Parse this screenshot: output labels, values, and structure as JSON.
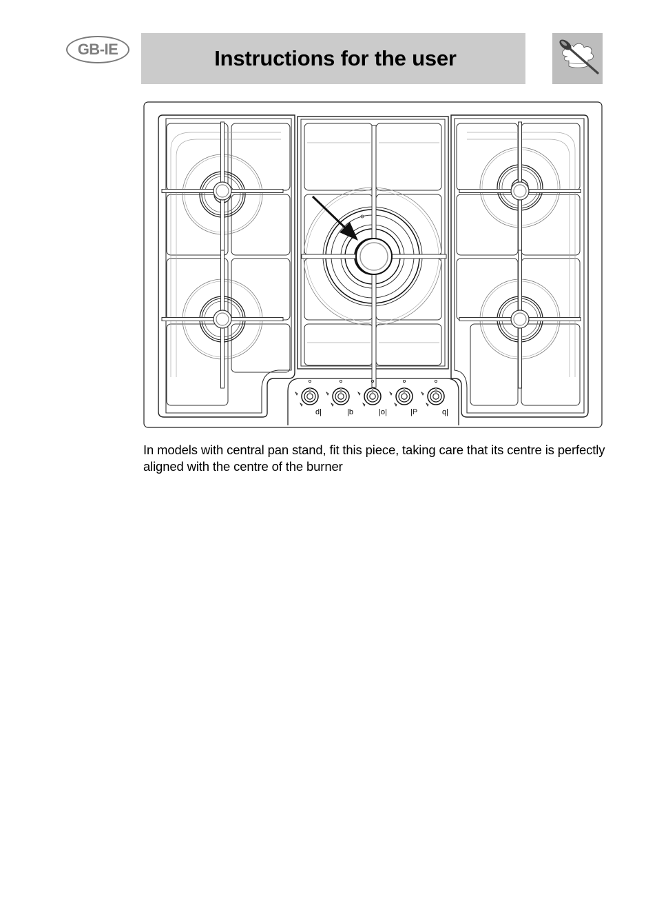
{
  "header": {
    "country_code": "GB-IE",
    "title": "Instructions for the user",
    "section_icon": "chef-hat-spoon-icon"
  },
  "figure": {
    "subject": "gas hob top view with five burners and central pan stand",
    "annotation": "arrow-pointing-to-central-burner",
    "burners": [
      {
        "position": "rear-left",
        "type": "semi-rapid"
      },
      {
        "position": "front-left",
        "type": "auxiliary"
      },
      {
        "position": "centre",
        "type": "triple-ring"
      },
      {
        "position": "rear-right",
        "type": "semi-rapid"
      },
      {
        "position": "front-right",
        "type": "rapid"
      }
    ],
    "knobs": [
      {
        "label": "d|"
      },
      {
        "label": "|b"
      },
      {
        "label": "|o|"
      },
      {
        "label": "|P"
      },
      {
        "label": "q|"
      }
    ]
  },
  "body": {
    "caption": "In models with central pan stand, fit this piece, taking care that its centre is perfectly aligned with the centre of the burner"
  },
  "colors": {
    "title_bar": "#cbcbcb",
    "badge_text": "#7d7d7d",
    "icon_bg": "#bdbdbd"
  }
}
